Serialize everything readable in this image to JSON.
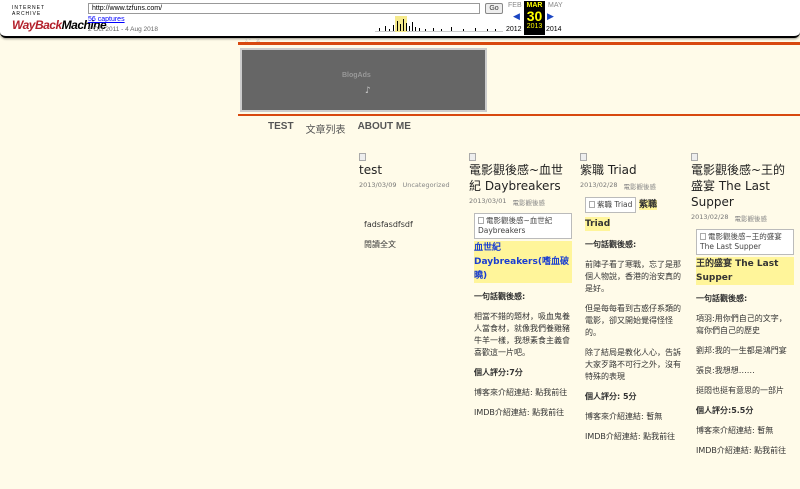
{
  "wayback": {
    "logo_top": "INTERNET ARCHIVE",
    "logo_main_1": "WayBack",
    "logo_main_2": "Machine",
    "url": "http://www.tzfuns.com/",
    "go_label": "Go",
    "captures": "56 captures",
    "range": "2 Oct 2011 - 4 Aug 2018",
    "prev_month": "FEB",
    "cur_month": "MAR",
    "next_month": "MAY",
    "cur_day": "30",
    "prev_year": "2012",
    "cur_year": "2013",
    "next_year": "2014",
    "prev_arrow": "◀",
    "next_arrow": "▶"
  },
  "page": {
    "tiny_link": "ふ゛ろ",
    "ad_label": "BlogAds",
    "ad_glyph": "♪"
  },
  "nav": {
    "items": [
      "TEST",
      "文章列表",
      "ABOUT ME"
    ]
  },
  "posts": [
    {
      "title": "test",
      "date": "2013/03/09",
      "category": "Uncategorized",
      "body_1": "fadsfasdfsdf",
      "body_2": "閱讀全文"
    },
    {
      "title": "電影觀後感~血世紀 Daybreakers",
      "date": "2013/03/01",
      "category": "電影觀後感",
      "img_alt": "電影觀後感~血世紀 Daybreakers",
      "heading": "血世紀 Daybreakers(嗜血破曉)",
      "sub": "一句話觀後感:",
      "p1": "相當不錯的題材，吸血鬼養人當食材，就像我們養雞豬牛羊一樣，我想素食主義會喜歡這一片吧。",
      "rating": "個人評分:7分",
      "blog_link": "博客來介紹連結: 點我前往",
      "imdb_link": "IMDB介紹連結: 點我前往"
    },
    {
      "title": "紫職 Triad",
      "date": "2013/02/28",
      "category": "電影觀後感",
      "img_alt": "紫職 Triad",
      "heading_1": "紫職",
      "heading_2": "Triad",
      "sub": "一句話觀後感:",
      "p1": "前陣子看了寒戰，忘了是那個人物說，香港的治安真的是好。",
      "p2": "但是每每看到古惑仔系類的電影，卻又開始覺得怪怪的。",
      "p3": "除了結局是教化人心，告訴大家歹路不可行之外，沒有特殊的表現",
      "rating": "個人評分: 5分",
      "blog_link": "博客來介紹連結: 暫無",
      "imdb_link": "IMDB介紹連結: 點我前往"
    },
    {
      "title": "電影觀後感~王的盛宴 The Last Supper",
      "date": "2013/02/28",
      "category": "電影觀後感",
      "img_alt": "電影觀後感~王的盛宴 The Last Supper",
      "heading": "王的盛宴 The Last Supper",
      "sub": "一句話觀後感:",
      "p1": "項羽:用你們自己的文字，寫你們自己的歷史",
      "p2": "劉邦:我的一生都是鴻門宴",
      "p3": "張良:我想想……",
      "p4": "挺悶也挺有意思的一部片",
      "rating": "個人評分:5.5分",
      "blog_link": "博客來介紹連結: 暫無",
      "imdb_link": "IMDB介紹連結: 點我前往"
    }
  ]
}
